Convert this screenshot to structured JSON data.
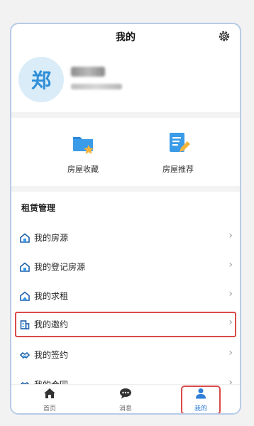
{
  "header": {
    "title": "我的"
  },
  "profile": {
    "avatar_text": "郑"
  },
  "quick_actions": [
    {
      "label": "房屋收藏",
      "icon": "folder-star-icon"
    },
    {
      "label": "房屋推荐",
      "icon": "document-edit-icon"
    }
  ],
  "section": {
    "title": "租赁管理",
    "items": [
      {
        "label": "我的房源",
        "icon": "house-icon"
      },
      {
        "label": "我的登记房源",
        "icon": "house-icon"
      },
      {
        "label": "我的求租",
        "icon": "house-search-icon"
      },
      {
        "label": "我的邀约",
        "icon": "building-icon",
        "highlighted": true
      },
      {
        "label": "我的签约",
        "icon": "handshake-icon"
      },
      {
        "label": "我的合同",
        "icon": "handshake-icon"
      }
    ]
  },
  "tabbar": {
    "items": [
      {
        "label": "首页",
        "icon": "home-icon"
      },
      {
        "label": "消息",
        "icon": "chat-icon"
      },
      {
        "label": "我的",
        "icon": "person-icon",
        "active": true
      }
    ]
  },
  "colors": {
    "accent": "#2f7ed8",
    "highlight": "#d94a4a",
    "avatar_bg": "#d9ecf8"
  }
}
